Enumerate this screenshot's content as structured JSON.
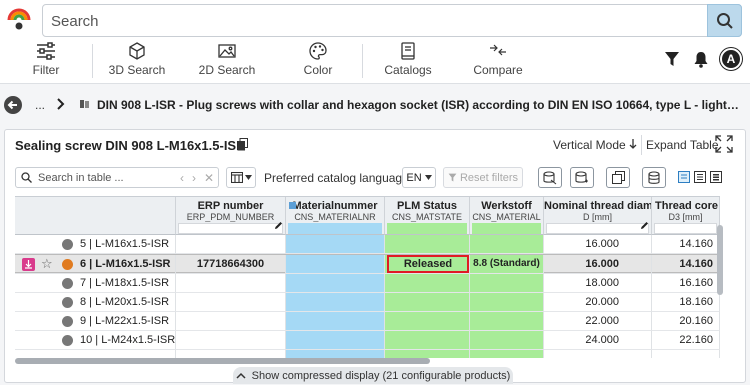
{
  "search": {
    "placeholder": "Search"
  },
  "toolbar": {
    "items": [
      {
        "label": "Filter",
        "icon": "sliders-icon"
      },
      {
        "label": "3D Search",
        "icon": "cube-icon"
      },
      {
        "label": "2D Search",
        "icon": "image-icon"
      },
      {
        "label": "Color",
        "icon": "palette-icon"
      },
      {
        "label": "Catalogs",
        "icon": "book-icon"
      },
      {
        "label": "Compare",
        "icon": "compare-arrows-icon"
      }
    ],
    "avatar_letter": "A"
  },
  "breadcrumb": {
    "ellipsis": "...",
    "text": "DIN 908 L-ISR - Plug screws with collar and hexagon socket (ISR) according to DIN EN ISO 10664, type L - light version, cylindrical thread"
  },
  "panel": {
    "title": "Sealing screw DIN 908 L-M16x1.5-ISR",
    "vertical_mode": "Vertical Mode",
    "expand_table": "Expand Table",
    "search_placeholder": "Search in table ...",
    "preferred_language_label": "Preferred catalog language",
    "language": "EN",
    "reset_filters": "Reset filters",
    "compressed_display": "Show compressed display (21 configurable products)"
  },
  "table": {
    "columns": [
      {
        "title": "ERP number",
        "sub": "ERP_PDM_NUMBER"
      },
      {
        "title": "Materialnummer",
        "sub": "CNS_MATERIALNR"
      },
      {
        "title": "PLM Status",
        "sub": "CNS_MATSTATE"
      },
      {
        "title": "Werkstoff",
        "sub": "CNS_MATERIAL"
      },
      {
        "title": "Nominal thread diam...",
        "sub": "D [mm]"
      },
      {
        "title": "Thread core di",
        "sub": "D3 [mm]"
      }
    ],
    "rows": [
      {
        "name": "5 | L-M16x1.5-ISR",
        "erp": "",
        "plm": "",
        "werkstoff": "",
        "d": "16.000",
        "d3": "14.160"
      },
      {
        "name": "6 | L-M16x1.5-ISR",
        "erp": "17718664300",
        "plm": "Released",
        "werkstoff": "8.8 (Standard)",
        "d": "16.000",
        "d3": "14.160"
      },
      {
        "name": "7 | L-M18x1.5-ISR",
        "erp": "",
        "plm": "",
        "werkstoff": "",
        "d": "18.000",
        "d3": "16.160"
      },
      {
        "name": "8 | L-M20x1.5-ISR",
        "erp": "",
        "plm": "",
        "werkstoff": "",
        "d": "20.000",
        "d3": "18.160"
      },
      {
        "name": "9 | L-M22x1.5-ISR",
        "erp": "",
        "plm": "",
        "werkstoff": "",
        "d": "22.000",
        "d3": "20.160"
      },
      {
        "name": "10 | L-M24x1.5-ISR",
        "erp": "",
        "plm": "",
        "werkstoff": "",
        "d": "24.000",
        "d3": "22.160"
      }
    ]
  },
  "colors": {
    "materialnummer_bg": "#a5d9f5",
    "plm_bg": "#a8ec98",
    "released_border": "#e01b24",
    "search_button": "#bcd9ec"
  }
}
